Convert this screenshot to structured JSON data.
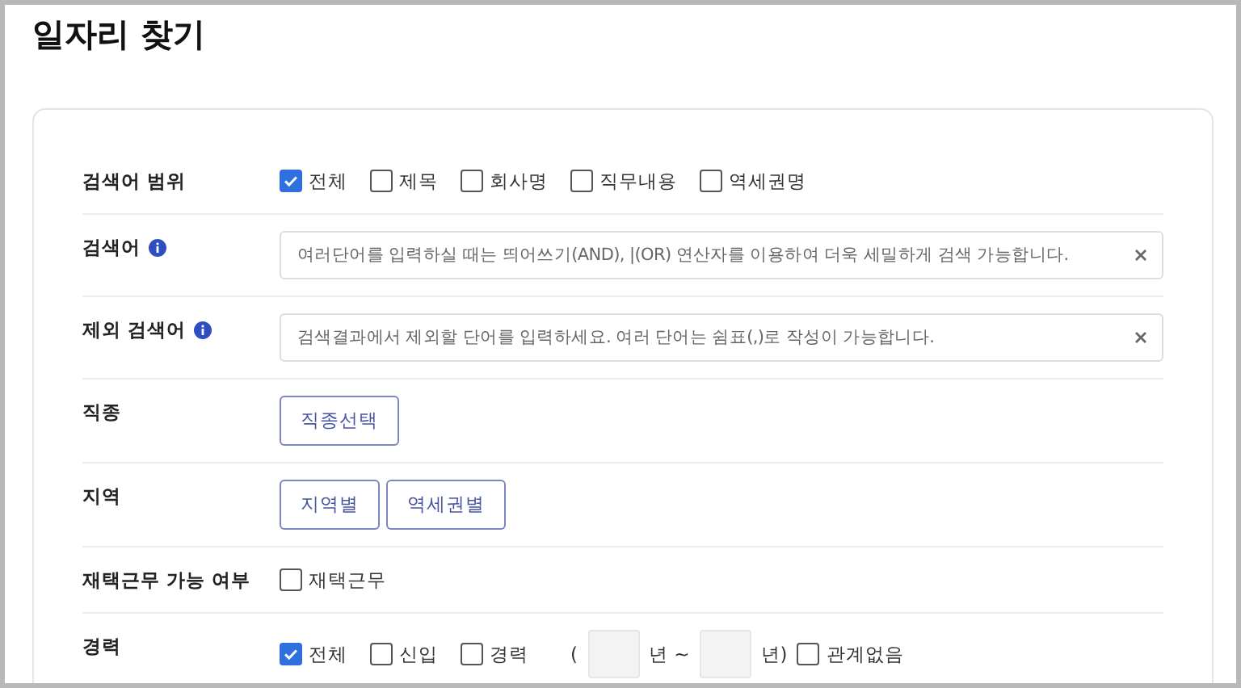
{
  "page": {
    "title": "일자리 찾기"
  },
  "rows": [
    {
      "kind": "checkboxes",
      "label": "검색어 범위",
      "options": [
        {
          "label": "전체",
          "checked": true
        },
        {
          "label": "제목",
          "checked": false
        },
        {
          "label": "회사명",
          "checked": false
        },
        {
          "label": "직무내용",
          "checked": false
        },
        {
          "label": "역세권명",
          "checked": false
        }
      ]
    },
    {
      "kind": "field",
      "label": "검색어",
      "info": true,
      "placeholder": "여러단어를 입력하실 때는 띄어쓰기(AND), |(OR) 연산자를 이용하여 더욱 세밀하게 검색 가능합니다."
    },
    {
      "kind": "field",
      "label": "제외 검색어",
      "info": true,
      "placeholder": "검색결과에서 제외할 단어를 입력하세요. 여러 단어는 쉼표(,)로 작성이 가능합니다."
    },
    {
      "kind": "buttons",
      "label": "직종",
      "buttons": [
        "직종선택"
      ]
    },
    {
      "kind": "buttons",
      "label": "지역",
      "buttons": [
        "지역별",
        "역세권별"
      ]
    },
    {
      "kind": "checkboxes",
      "label": "재택근무 가능 여부",
      "options": [
        {
          "label": "재택근무",
          "checked": false
        }
      ]
    },
    {
      "kind": "experience",
      "label": "경력",
      "options": [
        {
          "label": "전체",
          "checked": true
        },
        {
          "label": "신입",
          "checked": false
        },
        {
          "label": "경력",
          "checked": false
        }
      ],
      "open_paren": "(",
      "from_unit": "년 ~",
      "to_unit": "년)",
      "extra_option": {
        "label": "관계없음",
        "checked": false
      }
    }
  ]
}
